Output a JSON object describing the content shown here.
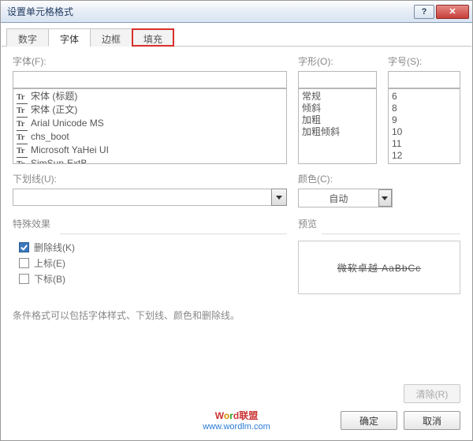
{
  "title": "设置单元格格式",
  "tabs": {
    "number": "数字",
    "font": "字体",
    "border": "边框",
    "fill": "填充"
  },
  "labels": {
    "font": "字体(F):",
    "style": "字形(O):",
    "size": "字号(S):",
    "underline": "下划线(U):",
    "color": "颜色(C):",
    "special": "特殊效果",
    "preview": "预览"
  },
  "fontList": {
    "i0": "宋体 (标题)",
    "i1": "宋体 (正文)",
    "i2": "Arial Unicode MS",
    "i3": "chs_boot",
    "i4": "Microsoft YaHei UI",
    "i5": "SimSun-ExtB"
  },
  "styleList": {
    "i0": "常规",
    "i1": "倾斜",
    "i2": "加粗",
    "i3": "加粗倾斜"
  },
  "sizeList": {
    "i0": "6",
    "i1": "8",
    "i2": "9",
    "i3": "10",
    "i4": "11",
    "i5": "12"
  },
  "underlineValue": "",
  "colorValue": "自动",
  "effects": {
    "strike": "删除线(K)",
    "super": "上标(E)",
    "sub": "下标(B)"
  },
  "previewText": "微软卓越  AaBbCc",
  "note": "条件格式可以包括字体样式、下划线、颜色和删除线。",
  "buttons": {
    "clear": "清除(R)",
    "ok": "确定",
    "cancel": "取消"
  },
  "watermark": {
    "brand_w": "W",
    "brand_o": "o",
    "brand_r": "r",
    "brand_d": "d",
    "brand_cn": "联盟",
    "url": "www.wordlm.com"
  }
}
